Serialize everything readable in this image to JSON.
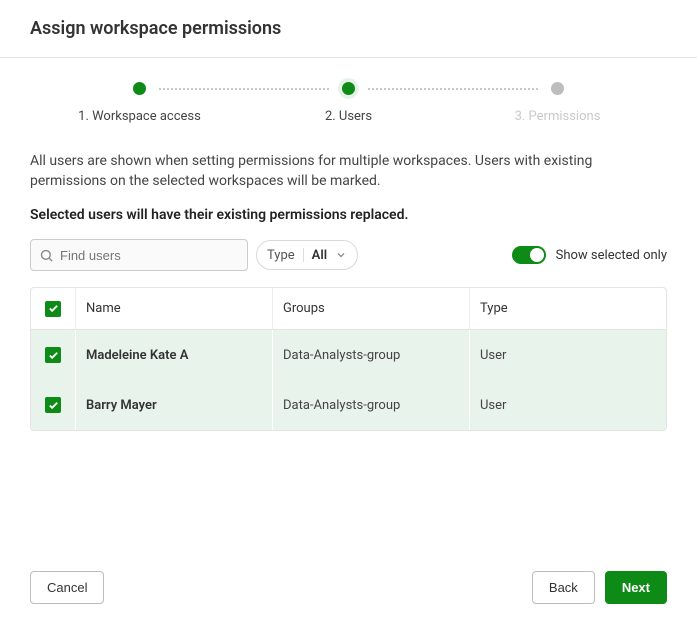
{
  "header": {
    "title": "Assign workspace permissions"
  },
  "stepper": {
    "step1": "1. Workspace access",
    "step2": "2. Users",
    "step3": "3. Permissions"
  },
  "description": "All users are shown when setting permissions for multiple workspaces. Users with existing permissions on the selected workspaces will be marked.",
  "warning": "Selected users will have their existing permissions replaced.",
  "search": {
    "placeholder": "Find users"
  },
  "type_filter": {
    "label": "Type",
    "value": "All"
  },
  "toggle": {
    "label": "Show selected only"
  },
  "table": {
    "headers": {
      "name": "Name",
      "groups": "Groups",
      "type": "Type"
    },
    "rows": [
      {
        "name": "Madeleine Kate A",
        "groups": "Data-Analysts-group",
        "type": "User"
      },
      {
        "name": "Barry Mayer",
        "groups": "Data-Analysts-group",
        "type": "User"
      }
    ]
  },
  "footer": {
    "cancel": "Cancel",
    "back": "Back",
    "next": "Next"
  }
}
